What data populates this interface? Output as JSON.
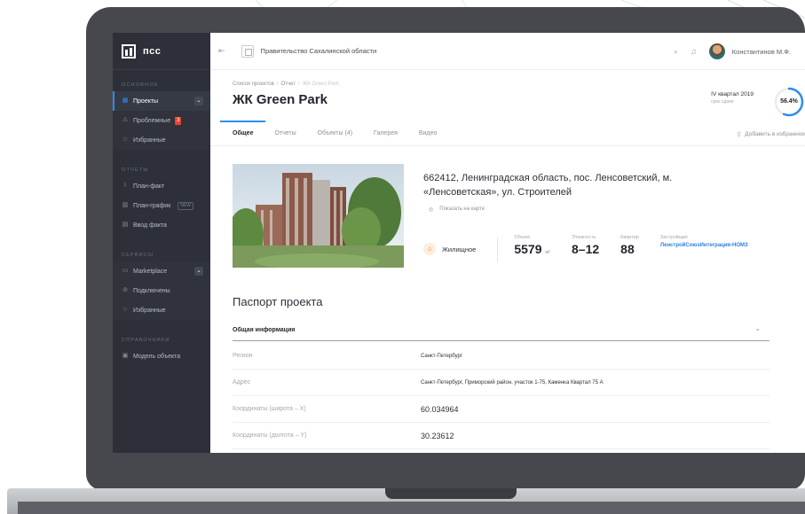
{
  "sidebar": {
    "logo": "псс",
    "sections": [
      {
        "title": "ОСНОВНОЕ"
      },
      {
        "title": "ОТЧЕТЫ"
      },
      {
        "title": "СЕРВИСЫ"
      },
      {
        "title": "СПРАВОЧНИКИ"
      }
    ],
    "items": {
      "projects": "Проекты",
      "problem": "Проблемные",
      "problem_count": "3",
      "favorites1": "Избранные",
      "planfact": "План-факт",
      "plangraph": "План-график",
      "new_badge": "NEW",
      "factinput": "Ввод факта",
      "marketplace": "Marketplace",
      "connected": "Подключены",
      "favorites2": "Избранные",
      "objmodel": "Модель объекта"
    }
  },
  "topbar": {
    "org": "Правительство Сахалинской области",
    "user": "Константинов М.Ф."
  },
  "header": {
    "breadcrumbs": [
      "Список проектов",
      "/",
      "Отчет",
      "/",
      "ЖК Green Park"
    ],
    "title": "ЖК Green Park",
    "quarter": "IV квартал 2019",
    "quarter_sub": "срок сдачи",
    "progress_label": "56.4%",
    "progress_value": 56.4
  },
  "tabs": {
    "items": [
      "Общее",
      "Отчеты",
      "Объекты (4)",
      "Галерея",
      "Видео"
    ],
    "favorite": "Добавить в избранное"
  },
  "project": {
    "address": "662412, Ленинградская область, пос. Ленсоветский, м. «Ленсоветская», ул. Строителей",
    "map_link": "Показать на карте",
    "type": "Жилищное",
    "volume_label": "Объем",
    "volume": "5579",
    "volume_unit": "м²",
    "floors_label": "Этажность",
    "floors": "8–12",
    "apts_label": "Квартир",
    "apts": "88",
    "developer_label": "Застройщик",
    "developer": "ЛенстройСоюзИнтеграция-НОМЗ"
  },
  "passport": {
    "title": "Паспорт проекта",
    "section": "Общая информация",
    "rows": [
      {
        "k": "Регион",
        "v": "Санкт-Петербург"
      },
      {
        "k": "Адрес",
        "v": "Санкт-Петербург, Приморский район, участок 1-75, Каменка Квартал 75 А"
      },
      {
        "k": "Координаты (широта – X)",
        "v": "60.034964"
      },
      {
        "k": "Координаты (долгота – Y)",
        "v": "30.23612"
      }
    ]
  },
  "colors": {
    "accent": "#2d8cf0",
    "sidebar": "#2d3038",
    "badge": "#e8452d",
    "developer": "#2d7fdc"
  }
}
